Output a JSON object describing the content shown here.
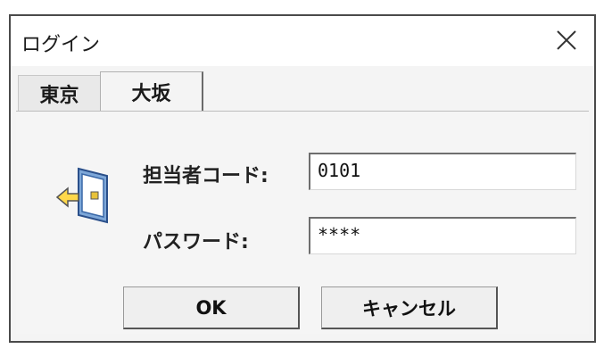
{
  "window": {
    "title": "ログイン",
    "close_label": "×"
  },
  "tabs": [
    {
      "label": "東京",
      "active": false
    },
    {
      "label": "大坂",
      "active": true
    }
  ],
  "form": {
    "code_label": "担当者コード:",
    "code_value": "0101",
    "password_label": "パスワード:",
    "password_value": "****"
  },
  "buttons": {
    "ok_label": "OK",
    "cancel_label": "キャンセル"
  },
  "icons": {
    "app": "login-door-icon",
    "close": "close-icon"
  }
}
